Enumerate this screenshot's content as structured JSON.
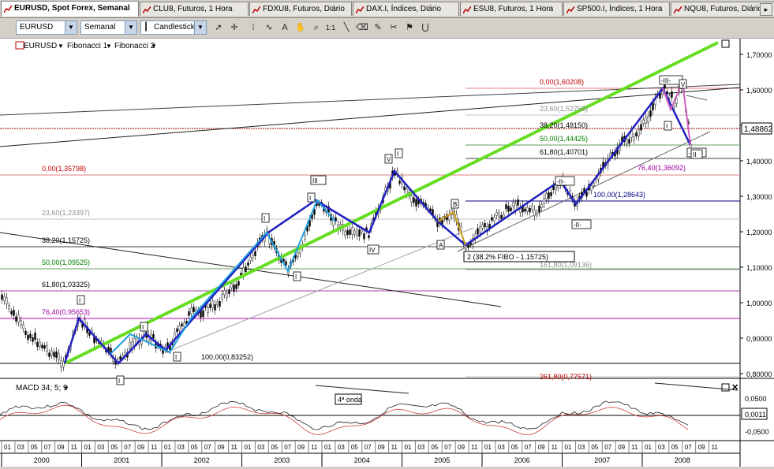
{
  "tabs": [
    {
      "label": "EURUSD, Spot Forex, Semanal",
      "active": true
    },
    {
      "label": "CLU8, Futuros, 1 Hora",
      "active": false
    },
    {
      "label": "FDXU8, Futuros, Diário",
      "active": false
    },
    {
      "label": "DAX.I, Índices, Diário",
      "active": false
    },
    {
      "label": "ESU8, Futuros, 1 Hora",
      "active": false
    },
    {
      "label": "SP500.I, Índices, 1 Hora",
      "active": false
    },
    {
      "label": "NQU8, Futuros, Diário",
      "active": false
    }
  ],
  "toolbar": {
    "symbol": "EURUSD",
    "period": "Semanal",
    "chart_type": "Candlestick",
    "zoom_label": "1:1"
  },
  "legend": {
    "symbol": "EURUSD",
    "study1": "Fibonacci 1",
    "study2": "Fibonacci 2"
  },
  "price_axis": {
    "ticks": [
      "1,70000",
      "1,60000",
      "1,50000",
      "1,40000",
      "1,30000",
      "1,20000",
      "1,10000",
      "1,00000",
      "0,90000",
      "0,80000"
    ],
    "current": "1,48862"
  },
  "fib1": [
    {
      "label": "0,00(1,35798)",
      "color": "#c00000"
    },
    {
      "label": "23,60(1,23397)",
      "color": "#909090"
    },
    {
      "label": "38,20(1,15725)",
      "color": "#000000"
    },
    {
      "label": "50,00(1,09525)",
      "color": "#008000"
    },
    {
      "label": "61,80(1,03325)",
      "color": "#000000"
    },
    {
      "label": "76,40(0,95653)",
      "color": "#a000a0"
    },
    {
      "label": "100,00(0,83252)",
      "color": "#000000"
    }
  ],
  "fib2": [
    {
      "label": "0,00(1,60208)",
      "color": "#c00000"
    },
    {
      "label": "23,60(1,52758)",
      "color": "#909090"
    },
    {
      "label": "38,20(1,48150)",
      "color": "#000000"
    },
    {
      "label": "50,00(1,44425)",
      "color": "#008000"
    },
    {
      "label": "61,80(1,40701)",
      "color": "#000000"
    },
    {
      "label": "76,40(1,36092)",
      "color": "#a000a0"
    },
    {
      "label": "100,00(1,28643)",
      "color": "#000080"
    },
    {
      "label": "161,80(1,09136)",
      "color": "#909090"
    },
    {
      "label": "261,80(0,77571)",
      "color": "#c00000"
    }
  ],
  "wave_labels": {
    "w1a": "I",
    "w1b": "I",
    "w1c": "I",
    "w1d": "I",
    "w3a": "III",
    "w3b": "I",
    "w3c": "I",
    "w3d": "I",
    "w4": "IV",
    "w5v": "V",
    "w5i": "I",
    "wA": "A",
    "wB": "B",
    "wII": "-II-",
    "wIIb": "-II-",
    "wIII": "-III-",
    "wIV": "-IV-",
    "wV": "V",
    "wI2": "I",
    "wII2": "II"
  },
  "annotation": "2 (38.2% FIBO - 1.15725)",
  "macd": {
    "title": "MACD 34; 5; 9",
    "note": "4ª onda",
    "ticks": [
      "0,0500",
      "-0,0500"
    ],
    "current": "0,0011"
  },
  "time_axis": {
    "months": [
      "01",
      "03",
      "05",
      "07",
      "09",
      "11"
    ],
    "years": [
      "2000",
      "2001",
      "2002",
      "2003",
      "2004",
      "2005",
      "2006",
      "2007",
      "2008"
    ]
  }
}
